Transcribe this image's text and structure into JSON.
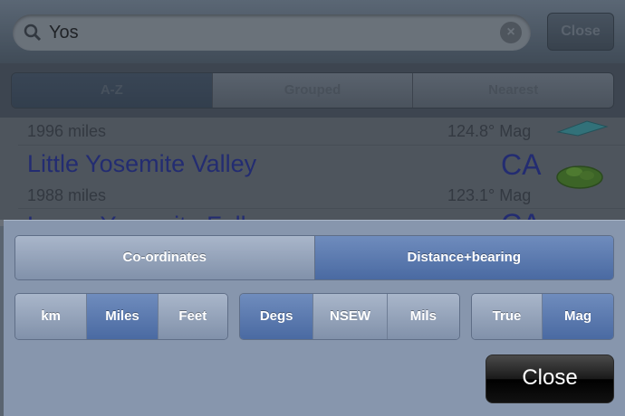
{
  "search": {
    "query": "Yos",
    "close_label": "Close"
  },
  "tabs": [
    {
      "label": "A-Z",
      "selected": true
    },
    {
      "label": "Grouped",
      "selected": false
    },
    {
      "label": "Nearest",
      "selected": false
    }
  ],
  "results": [
    {
      "distance": "1996 miles",
      "bearing": "124.8° Mag"
    },
    {
      "name": "Little Yosemite Valley",
      "state": "CA",
      "distance": "1988 miles",
      "bearing": "123.1° Mag"
    },
    {
      "name": "Lower Yosemite Falls",
      "state": "CA"
    }
  ],
  "settings": {
    "mode": {
      "options": [
        "Co-ordinates",
        "Distance+bearing"
      ],
      "selected": "Distance+bearing"
    },
    "units": {
      "options": [
        "km",
        "Miles",
        "Feet"
      ],
      "selected": "Miles"
    },
    "angle": {
      "options": [
        "Degs",
        "NSEW",
        "Mils"
      ],
      "selected": "Degs"
    },
    "north": {
      "options": [
        "True",
        "Mag"
      ],
      "selected": "Mag"
    },
    "close_label": "Close"
  },
  "colors": {
    "selected_segment": "#4a6aa2",
    "panel": "#8796ad",
    "link_text": "#1f2a9a"
  },
  "icons": [
    "search-icon",
    "clear-icon",
    "map-area-icon"
  ]
}
